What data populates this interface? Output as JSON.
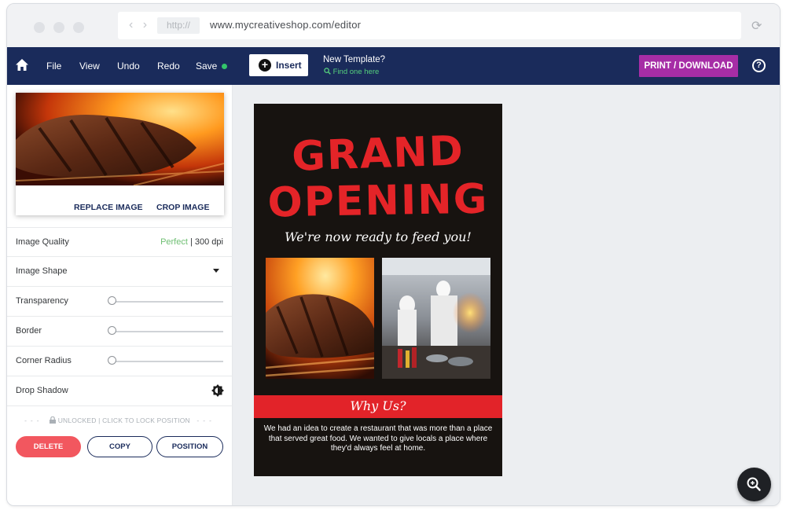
{
  "browser": {
    "protocol": "http://",
    "url": "www.mycreativeshop.com/editor"
  },
  "toolbar": {
    "file": "File",
    "view": "View",
    "undo": "Undo",
    "redo": "Redo",
    "save": "Save",
    "save_status_color": "#33c56a",
    "insert": "Insert",
    "new_template": "New Template?",
    "find_one": "Find one here",
    "print": "PRINT / DOWNLOAD",
    "help": "?"
  },
  "image_panel": {
    "replace": "REPLACE IMAGE",
    "crop": "CROP IMAGE"
  },
  "properties": {
    "quality_label": "Image Quality",
    "quality_status": "Perfect",
    "quality_dpi": "| 300 dpi",
    "shape_label": "Image Shape",
    "transparency_label": "Transparency",
    "transparency_value": 0,
    "border_label": "Border",
    "border_value": 0,
    "radius_label": "Corner Radius",
    "radius_value": 0,
    "shadow_label": "Drop Shadow",
    "lock_text": "UNLOCKED | CLICK TO LOCK POSITION"
  },
  "actions": {
    "delete": "DELETE",
    "copy": "COPY",
    "position": "POSITION"
  },
  "poster": {
    "title_line1": "GRAND",
    "title_line2": "OPENING",
    "subtitle": "We're now ready to feed you!",
    "banner": "Why Us?",
    "body": "We had an idea to create a restaurant that was more than a place that served great food. We wanted to give locals a place where they'd always feel at home.",
    "title_color": "#e42428",
    "background_color": "#171310"
  },
  "colors": {
    "navbar": "#1a2b5b",
    "print_button": "#a62da6",
    "delete_button": "#f2575f"
  }
}
